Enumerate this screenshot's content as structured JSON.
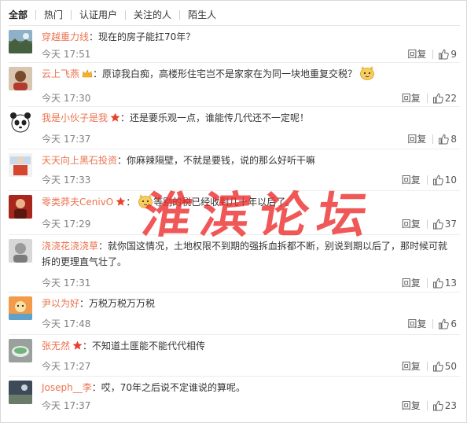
{
  "tabs": [
    "全部",
    "热门",
    "认证用户",
    "关注的人",
    "陌生人"
  ],
  "colors": {
    "username": "#eb7350",
    "text": "#333333",
    "meta": "#808080",
    "watermark": "#ec2828"
  },
  "watermark": {
    "text": [
      "淮",
      "滨",
      "论",
      "坛"
    ]
  },
  "comments": [
    {
      "user": "穿越重力线",
      "text": "现在的房子能扛70年？",
      "time": "今天 17:51",
      "reply": "回复",
      "likes": "9",
      "avatar_icon": "landscape-avatar-icon"
    },
    {
      "user": "云上飞燕",
      "text": "原谅我白痴，高楼形住宅岂不是家家在为同一块地重复交税？",
      "time": "今天 17:30",
      "reply": "回复",
      "likes": "22",
      "avatar_icon": "person-avatar-icon",
      "badge": "vip-crown-icon",
      "emoticon": "cat-face-emoticon"
    },
    {
      "user": "我是小伙子是我",
      "text": "还是要乐观一点，谁能传几代还不一定呢！",
      "time": "今天 17:37",
      "reply": "回复",
      "likes": "8",
      "avatar_icon": "panda-avatar-icon",
      "badge": "star-badge-icon"
    },
    {
      "user": "天天向上黑石投资",
      "text": "你麻辣隔壁，不就是要钱，说的那么好听干嘛",
      "time": "今天 17:33",
      "reply": "回复",
      "likes": "10",
      "avatar_icon": "cartoon-avatar-icon"
    },
    {
      "user": "零类莽夫CenivO",
      "text": "等别的税已经收到几十年以后了。",
      "time": "今天 17:29",
      "reply": "回复",
      "likes": "37",
      "avatar_icon": "red-figure-avatar-icon",
      "badge": "star-badge-icon",
      "emoticon": "cat-face-emoticon"
    },
    {
      "user": "浇浇花浇浇草",
      "text": "就你国这情况，土地权限不到期的强拆血拆都不断，别说到期以后了，那时候可就拆的更理直气壮了。",
      "time": "今天 17:31",
      "reply": "回复",
      "likes": "13",
      "avatar_icon": "sketch-avatar-icon"
    },
    {
      "user": "尹以为好",
      "text": "万税万税万万税",
      "time": "今天 17:48",
      "reply": "回复",
      "likes": "6",
      "avatar_icon": "colorful-avatar-icon"
    },
    {
      "user": "张无然",
      "text": "不知道土匪能不能代代相传",
      "time": "今天 17:27",
      "reply": "回复",
      "likes": "50",
      "avatar_icon": "bowl-avatar-icon",
      "badge": "star-badge-icon"
    },
    {
      "user": "Joseph__李",
      "text": "哎，70年之后说不定谁说的算呢。",
      "time": "今天 17:37",
      "reply": "回复",
      "likes": "23",
      "avatar_icon": "dark-photo-avatar-icon"
    }
  ]
}
